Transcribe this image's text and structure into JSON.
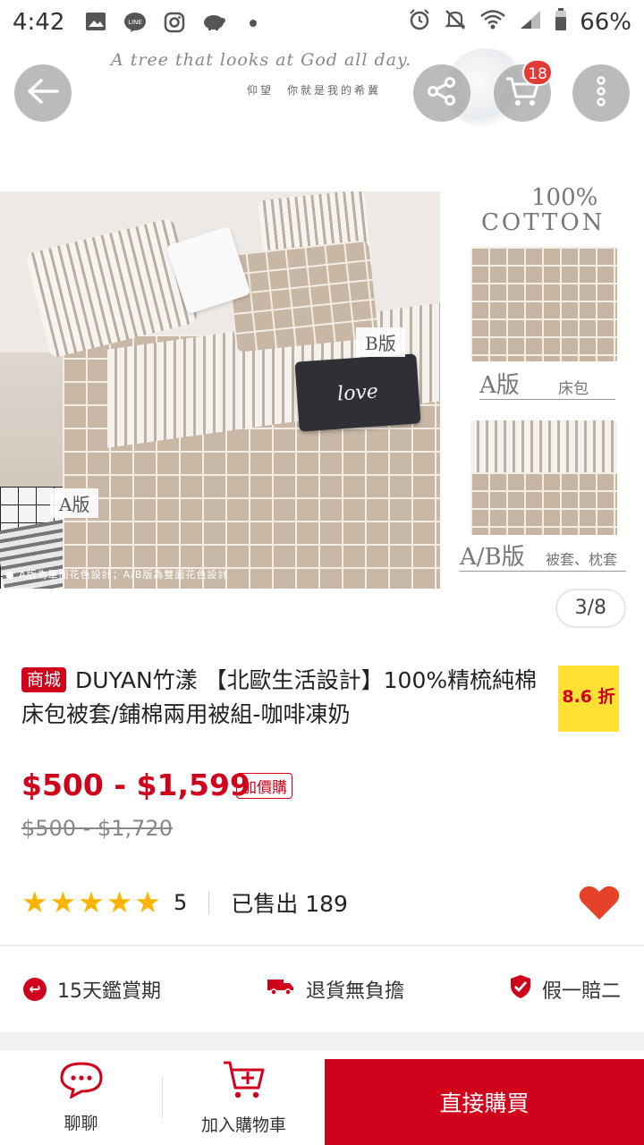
{
  "status_bar": {
    "time": "4:42",
    "left_icons": [
      "gallery-icon",
      "line-icon",
      "instagram-icon",
      "piggy-bank-icon",
      "dot-icon"
    ],
    "right_icons": [
      "alarm-icon",
      "mute-icon",
      "wifi-icon",
      "signal-icon",
      "battery-icon"
    ],
    "battery": "66%"
  },
  "banner": {
    "script_text": "A tree that looks at God all day.",
    "sub_text": "仰望　你就是我的希冀"
  },
  "header": {
    "cart_count": "18",
    "icons": [
      "back-arrow-icon",
      "share-icon",
      "cart-icon",
      "more-vertical-icon"
    ]
  },
  "gallery": {
    "cotton_pct": "100%",
    "cotton_word": "COTTON",
    "tag_a": "A版",
    "tag_b": "B版",
    "love_text": "love",
    "caption": "● A版為單面花色設計；A/B版為雙面花色設計",
    "thumb_a_label": "A版",
    "thumb_a_desc": "床包",
    "thumb_ab_label": "A/B版",
    "thumb_ab_desc": "被套、枕套",
    "page_indicator": "3/8"
  },
  "product": {
    "mall_badge": "商城",
    "title": "DUYAN竹漾 【北歐生活設計】100%精梳純棉床包被套/鋪棉兩用被組-咖啡凍奶",
    "discount": "8.6 折",
    "price": "$500 - $1,599",
    "addon_badge": "加價購",
    "original_price": "$500 - $1,720",
    "rating": 5,
    "rating_count": "5",
    "sold": "已售出 189"
  },
  "services": [
    {
      "icon": "return-icon",
      "label": "15天鑑賞期"
    },
    {
      "icon": "truck-icon",
      "label": "退貨無負擔"
    },
    {
      "icon": "shield-check-icon",
      "label": "假一賠二"
    }
  ],
  "bottom_bar": {
    "chat_label": "聊聊",
    "add_cart_label": "加入購物車",
    "buy_now_label": "直接購買"
  },
  "colors": {
    "brand_red": "#d0021b",
    "discount_yellow": "#ffe033",
    "star_gold": "#ffb400",
    "heart_red": "#e4432a"
  }
}
